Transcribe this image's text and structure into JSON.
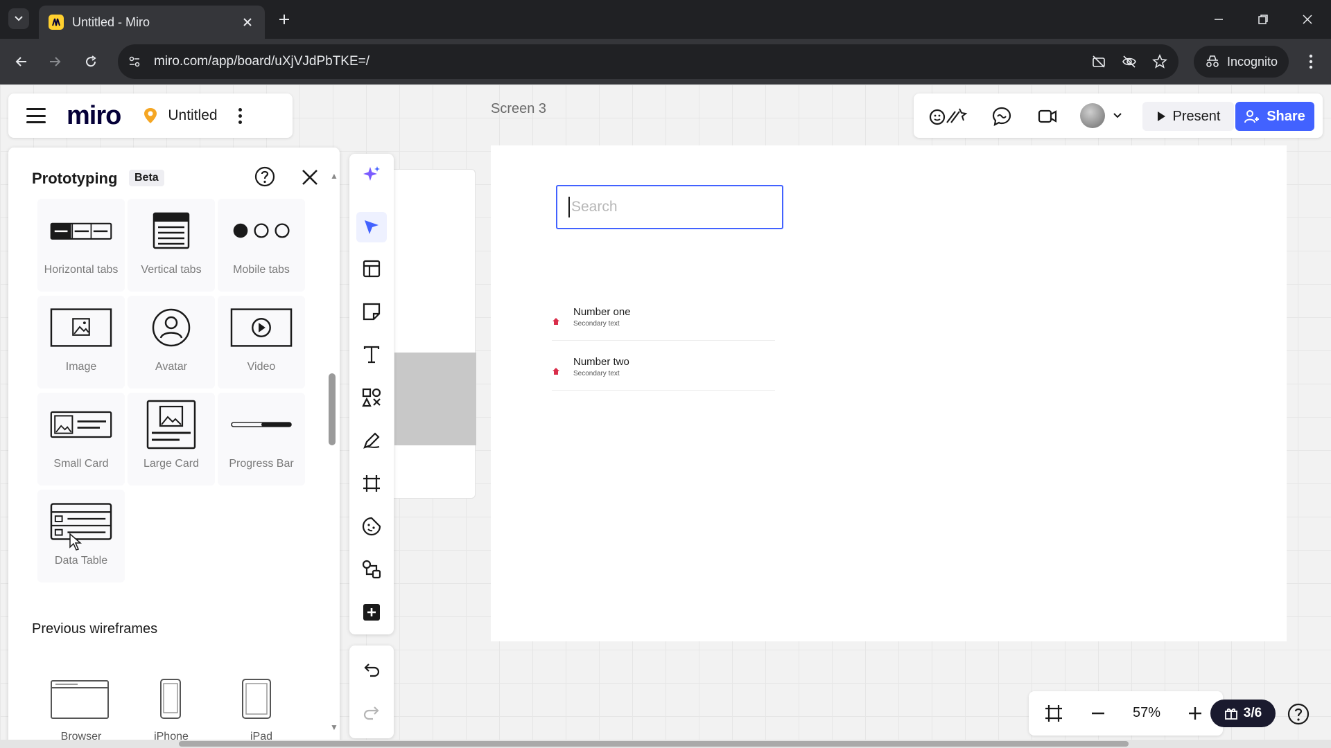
{
  "browser": {
    "tab_title": "Untitled - Miro",
    "url": "miro.com/app/board/uXjVJdPbTKE=/",
    "incognito_label": "Incognito"
  },
  "header": {
    "logo": "miro",
    "board_name": "Untitled"
  },
  "collab": {
    "present_label": "Present",
    "share_label": "Share"
  },
  "canvas": {
    "frame_label": "Screen 3",
    "search_placeholder": "Search",
    "list_items": [
      {
        "primary": "Number one",
        "secondary": "Secondary text"
      },
      {
        "primary": "Number two",
        "secondary": "Secondary text"
      }
    ]
  },
  "panel": {
    "title": "Prototyping",
    "badge": "Beta",
    "components": [
      {
        "label": "Horizontal tabs",
        "icon": "horizontal-tabs-icon"
      },
      {
        "label": "Vertical tabs",
        "icon": "vertical-tabs-icon"
      },
      {
        "label": "Mobile tabs",
        "icon": "mobile-tabs-icon"
      },
      {
        "label": "Image",
        "icon": "image-icon"
      },
      {
        "label": "Avatar",
        "icon": "avatar-icon"
      },
      {
        "label": "Video",
        "icon": "video-icon"
      },
      {
        "label": "Small Card",
        "icon": "small-card-icon"
      },
      {
        "label": "Large Card",
        "icon": "large-card-icon"
      },
      {
        "label": "Progress Bar",
        "icon": "progress-bar-icon"
      },
      {
        "label": "Data Table",
        "icon": "data-table-icon"
      }
    ],
    "previous_section": "Previous wireframes",
    "previous": [
      {
        "label": "Browser",
        "icon": "browser-wireframe-icon"
      },
      {
        "label": "iPhone",
        "icon": "iphone-wireframe-icon"
      },
      {
        "label": "iPad",
        "icon": "ipad-wireframe-icon"
      }
    ]
  },
  "zoom": {
    "level": "57%",
    "pages": "3/6"
  },
  "colors": {
    "accent": "#4262ff",
    "pin": "#d92d4a",
    "logo_yellow": "#ffd02f"
  }
}
